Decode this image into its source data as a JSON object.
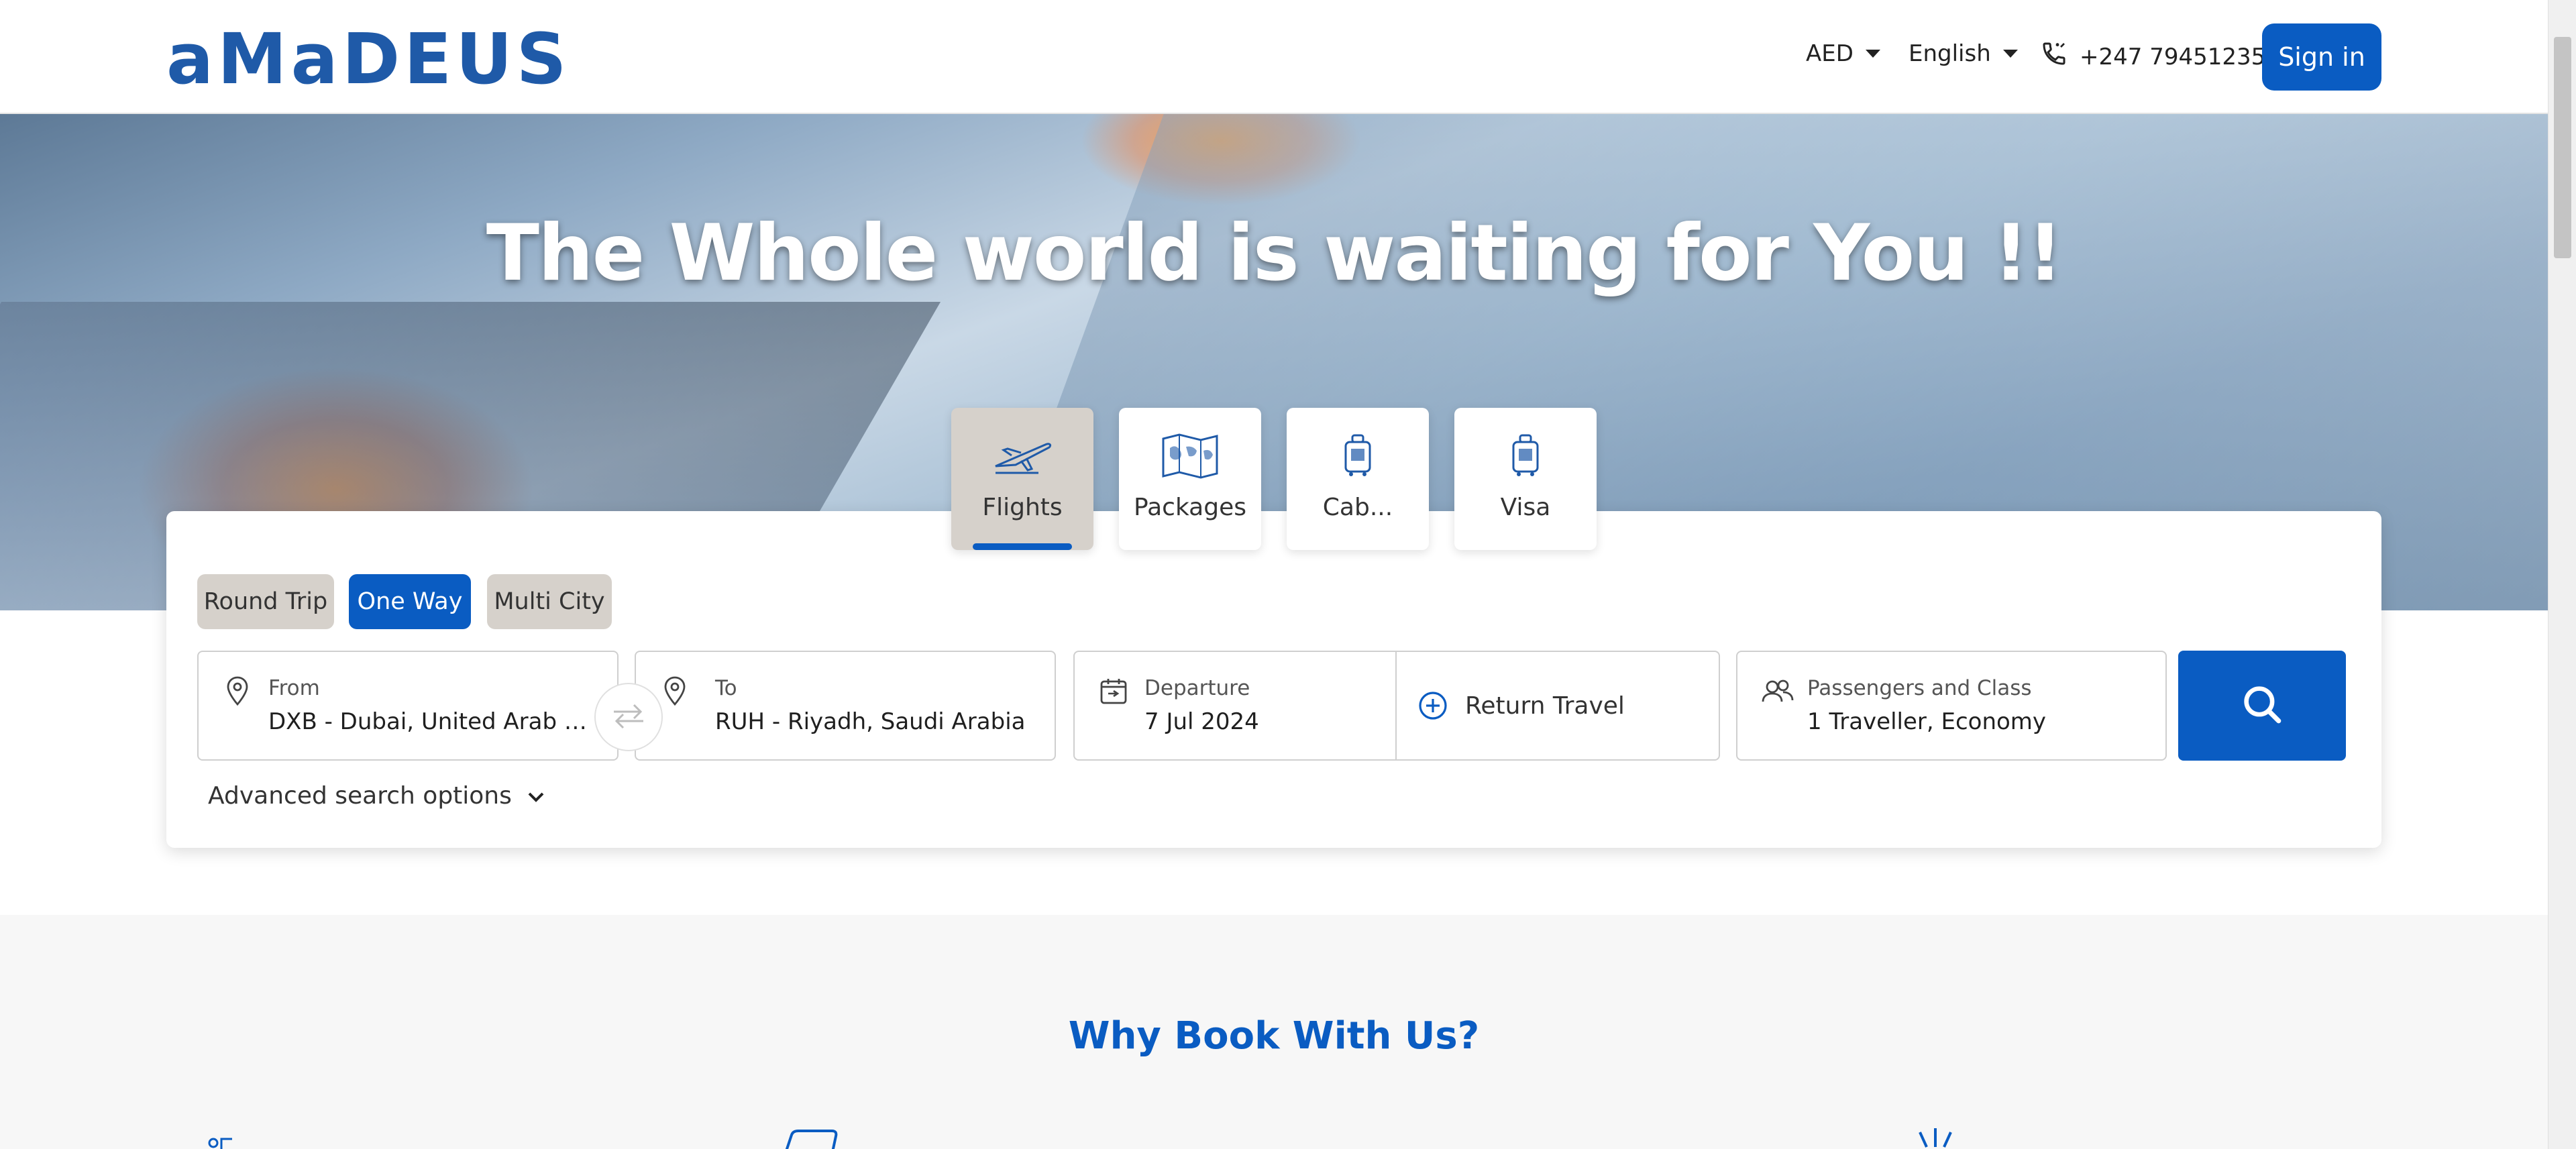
{
  "header": {
    "logo": "aMaDEUS",
    "currency": "AED",
    "language": "English",
    "phone": "+247 79451235",
    "signin_label": "Sign in"
  },
  "hero": {
    "title": "The Whole world is waiting for You !!"
  },
  "tabs": [
    {
      "label": "Flights",
      "icon": "plane-icon",
      "active": true
    },
    {
      "label": "Packages",
      "icon": "map-icon",
      "active": false
    },
    {
      "label": "Cab...",
      "icon": "luggage-icon",
      "active": false
    },
    {
      "label": "Visa",
      "icon": "luggage-icon",
      "active": false
    }
  ],
  "trip_types": [
    {
      "label": "Round Trip",
      "active": false
    },
    {
      "label": "One Way",
      "active": true
    },
    {
      "label": "Multi City",
      "active": false
    }
  ],
  "search": {
    "from": {
      "label": "From",
      "value": "DXB - Dubai, United Arab Emira..."
    },
    "to": {
      "label": "To",
      "value": "RUH - Riyadh, Saudi Arabia"
    },
    "departure": {
      "label": "Departure",
      "value": "7 Jul 2024"
    },
    "return_label": "Return Travel",
    "passengers": {
      "label": "Passengers and Class",
      "value": "1 Traveller, Economy"
    },
    "advanced_label": "Advanced search options"
  },
  "why": {
    "title": "Why Book With Us?"
  },
  "colors": {
    "brand": "#0a5cc2",
    "logo": "#1f5aa8",
    "tab_active_bg": "#d6d1cb"
  }
}
